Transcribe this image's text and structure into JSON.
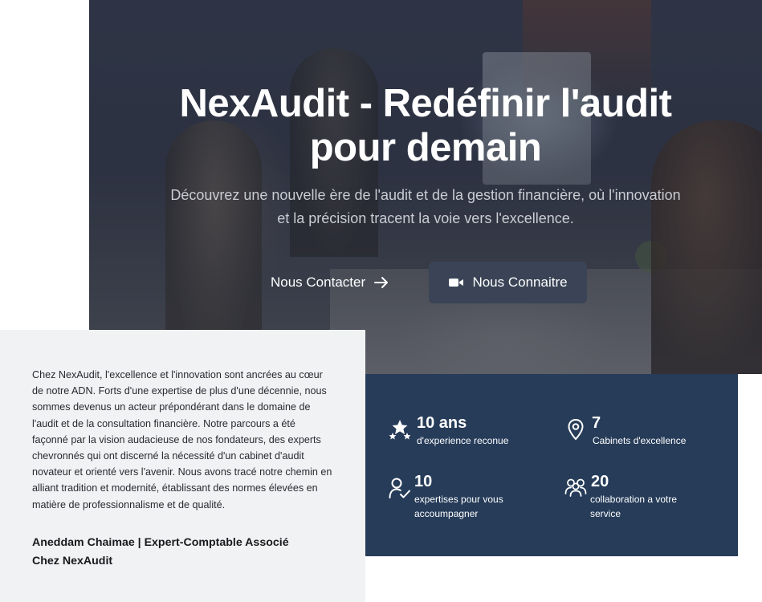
{
  "hero": {
    "title_line1": "NexAudit - Redéfinir l'audit",
    "title_line2": "pour demain",
    "subtitle_line1": "Découvrez une nouvelle ère de l'audit et de la gestion financière, où l'innovation",
    "subtitle_line2": "et la précision tracent la voie vers l'excellence.",
    "contact_label": "Nous Contacter",
    "know_label": "Nous Connaitre"
  },
  "about": {
    "text": "Chez NexAudit, l'excellence et l'innovation sont ancrées au cœur de notre ADN. Forts d'une expertise de plus d'une décennie, nous sommes devenus un acteur prépondérant dans le domaine de l'audit et de la consultation financière. Notre parcours a été façonné par la vision audacieuse de nos fondateurs, des experts chevronnés qui ont discerné la nécessité d'un cabinet d'audit novateur et orienté vers l'avenir. Nous avons tracé notre chemin en alliant tradition et modernité, établissant des normes élevées en matière de professionnalisme et de qualité.",
    "signature_line1": "Aneddam Chaimae | Expert-Comptable Associé",
    "signature_line2": "Chez NexAudit"
  },
  "stats": [
    {
      "icon": "stars-icon",
      "value": "10 ans",
      "label": "d'experience reconue"
    },
    {
      "icon": "map-pin-icon",
      "value": "7",
      "label": "Cabinets d'excellence"
    },
    {
      "icon": "user-check-icon",
      "value": "10",
      "label": "expertises pour vous accoumpagner"
    },
    {
      "icon": "users-icon",
      "value": "20",
      "label": "collaboration a votre service"
    }
  ],
  "colors": {
    "stats_bg": "#263c59",
    "about_bg": "#f1f2f4",
    "button_bg": "#3a4456"
  }
}
